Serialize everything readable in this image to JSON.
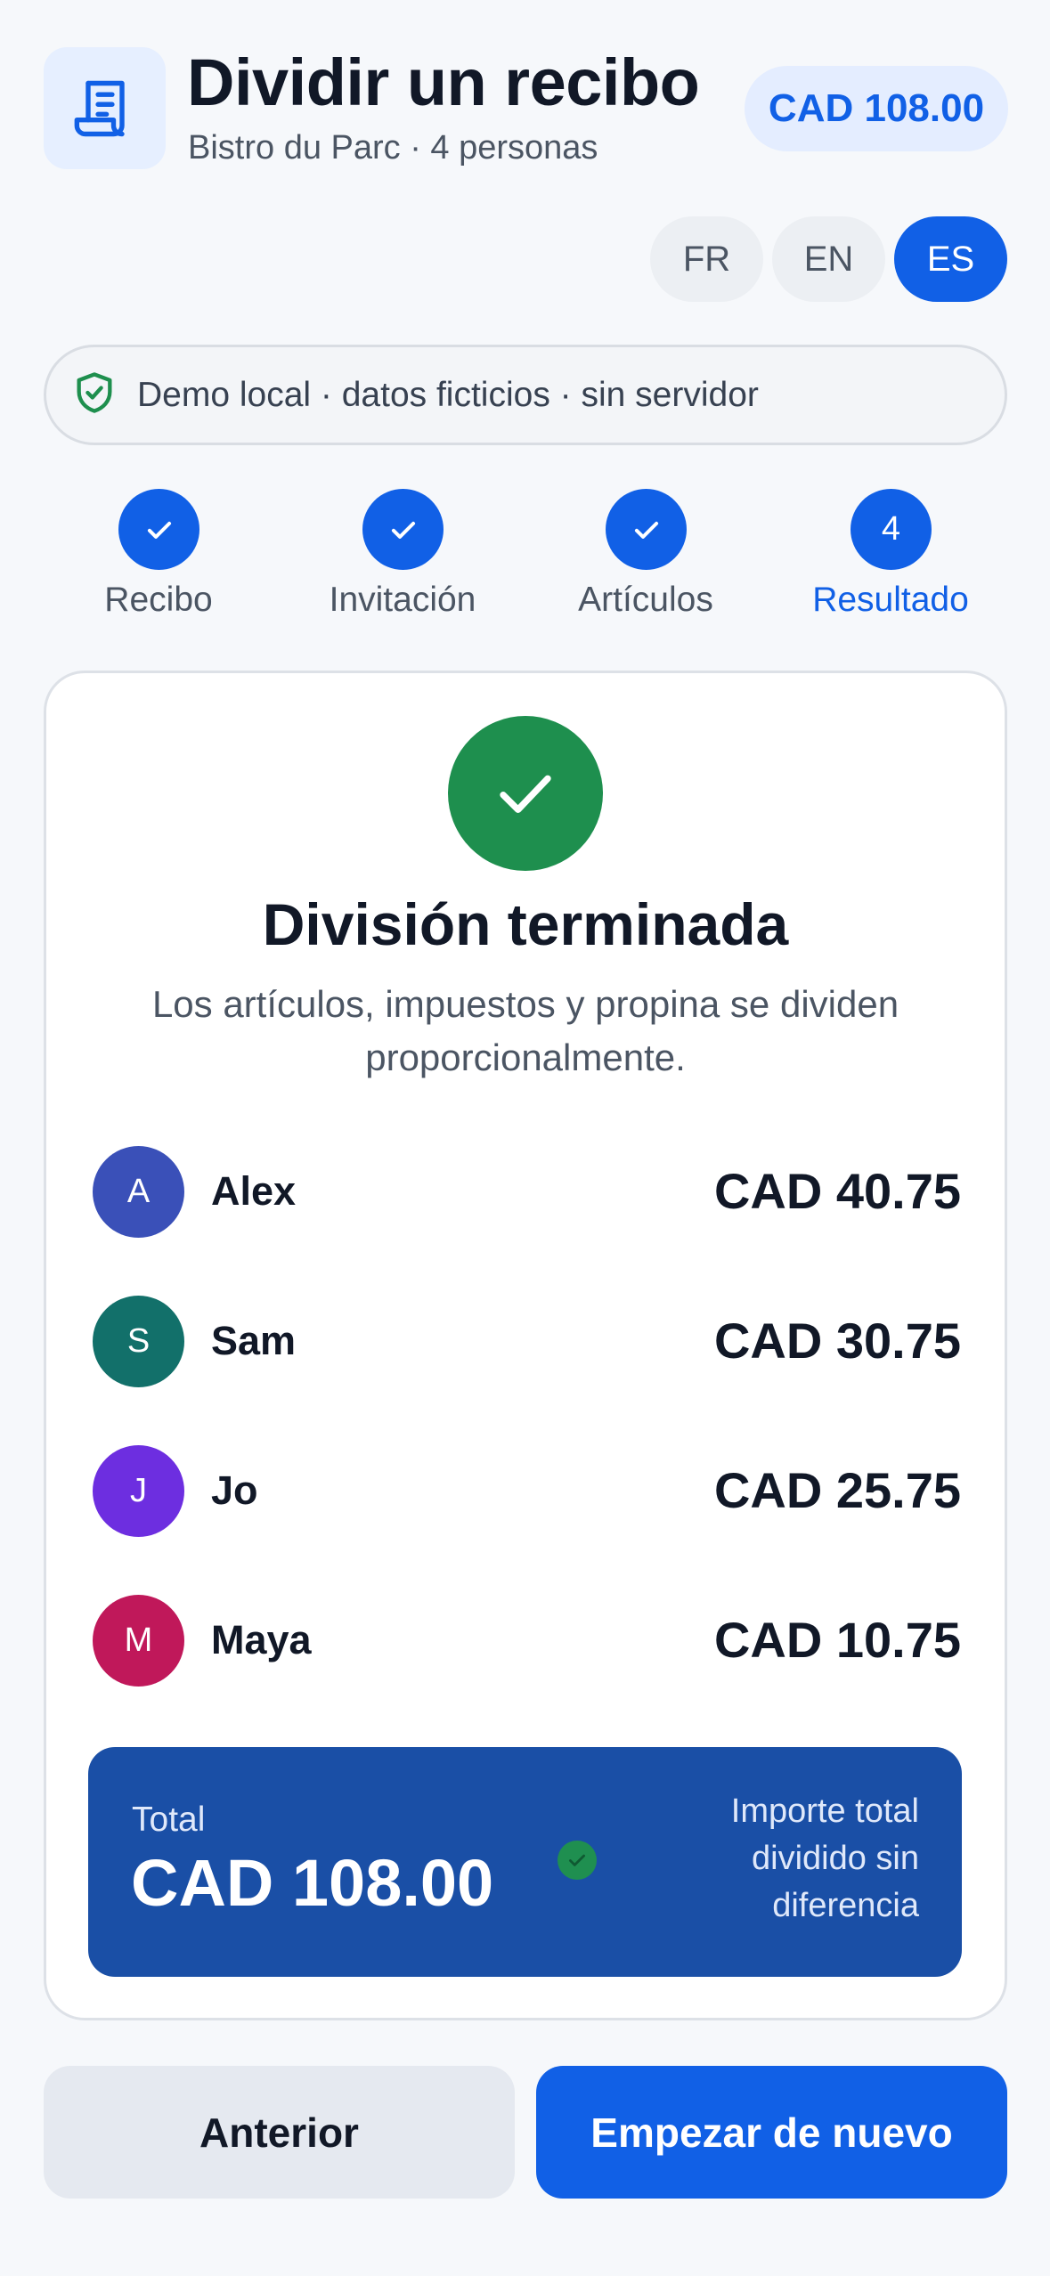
{
  "header": {
    "title": "Dividir un recibo",
    "subtitle": "Bistro du Parc · 4 personas",
    "total_pill": "CAD 108.00",
    "icon": "receipt-icon"
  },
  "languages": {
    "items": [
      {
        "label": "FR",
        "active": false
      },
      {
        "label": "EN",
        "active": false
      },
      {
        "label": "ES",
        "active": true
      }
    ]
  },
  "banner": {
    "icon": "shield-check-icon",
    "text": "Demo local · datos ficticios · sin servidor"
  },
  "stepper": {
    "steps": [
      {
        "label": "Recibo",
        "state": "done",
        "marker": "✓"
      },
      {
        "label": "Invitación",
        "state": "done",
        "marker": "✓"
      },
      {
        "label": "Artículos",
        "state": "done",
        "marker": "✓"
      },
      {
        "label": "Resultado",
        "state": "current",
        "marker": "4"
      }
    ]
  },
  "result": {
    "title": "División terminada",
    "description": "Los artículos, impuestos y propina se dividen proporcionalmente.",
    "people": [
      {
        "initial": "A",
        "name": "Alex",
        "amount": "CAD 40.75",
        "color": "#3a50b8"
      },
      {
        "initial": "S",
        "name": "Sam",
        "amount": "CAD 30.75",
        "color": "#12706a"
      },
      {
        "initial": "J",
        "name": "Jo",
        "amount": "CAD 25.75",
        "color": "#6d2ee0"
      },
      {
        "initial": "M",
        "name": "Maya",
        "amount": "CAD 10.75",
        "color": "#c0185a"
      }
    ],
    "total": {
      "label": "Total",
      "value": "CAD 108.00",
      "note": "Importe total dividido sin diferencia"
    }
  },
  "actions": {
    "previous": "Anterior",
    "restart": "Empezar de nuevo"
  },
  "colors": {
    "accent": "#1160e6",
    "success": "#1e8f4e",
    "total_box": "#1a4fa6"
  }
}
